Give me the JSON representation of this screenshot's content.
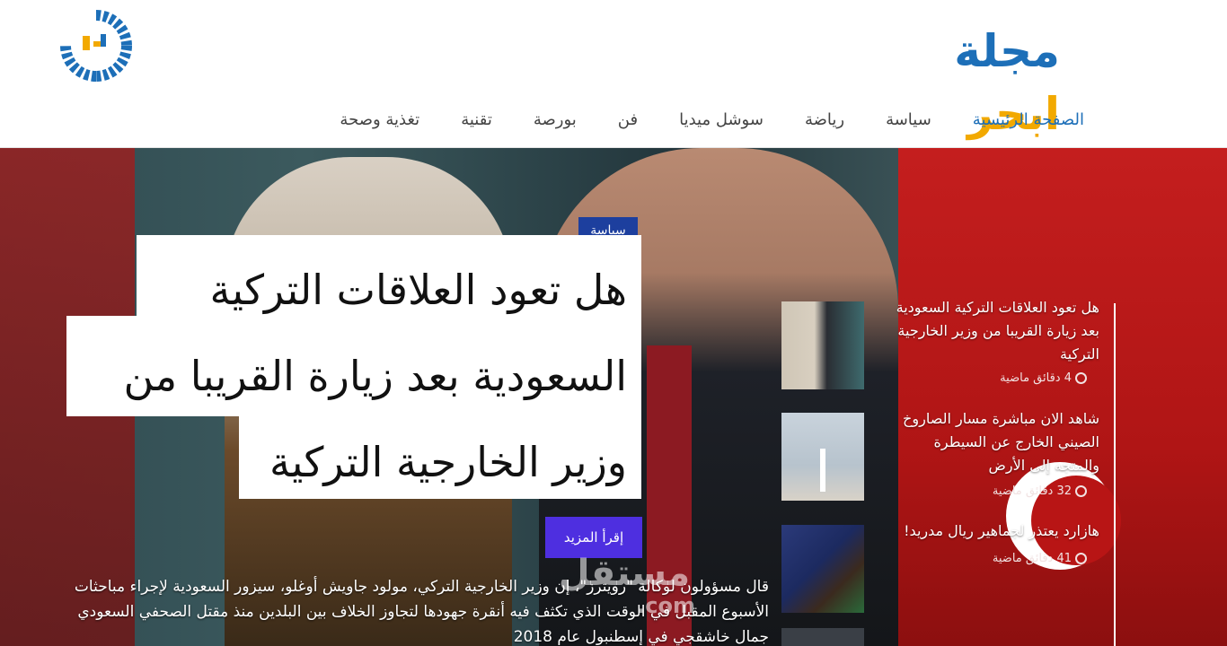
{
  "brand": {
    "word1": "مجلة",
    "word2": "ابحر"
  },
  "nav": {
    "items": [
      {
        "label": "الصفحة الرئيسية"
      },
      {
        "label": "سياسة"
      },
      {
        "label": "رياضة"
      },
      {
        "label": "سوشل ميديا"
      },
      {
        "label": "فن"
      },
      {
        "label": "بورصة"
      },
      {
        "label": "تقنية"
      },
      {
        "label": "تغذية وصحة"
      }
    ]
  },
  "hero": {
    "category": "سياسة",
    "title": "هل تعود العلاقات التركية السعودية بعد زيارة القريبا من وزير الخارجية التركية",
    "read_more": "إقرأ المزيد",
    "excerpt": "قال مسؤولون لوكالة \"رويترز\"، إن وزير الخارجية التركي، مولود جاويش أوغلو، سيزور السعودية لإجراء مباحثات الأسبوع المقبل في الوقت الذي تكثف فيه أنقرة جهودها لتجاوز الخلاف بين البلدين منذ مقتل الصحفي السعودي جمال خاشقجي في إسطنبول عام 2018"
  },
  "watermark": {
    "text": "مستقل",
    "domain": ".com"
  },
  "side_news": [
    {
      "title": "هل تعود العلاقات التركية السعودية بعد زيارة القريبا من وزير الخارجية التركية",
      "time": "4 دقائق ماضية"
    },
    {
      "title": "شاهد الان مباشرة مسار الصاروخ الصيني الخارج عن السيطرة والمتجه إلى الأرض",
      "time": "32 دقائق ماضية"
    },
    {
      "title": "هازارد يعتذر لجماهير ريال مدريد!",
      "time": "41 دقائق ماضية"
    }
  ],
  "colors": {
    "brand_blue": "#1d6fb8",
    "brand_gold": "#f2a900",
    "tag_bg": "#1d3f9e",
    "button_bg": "#4e2fe0"
  }
}
